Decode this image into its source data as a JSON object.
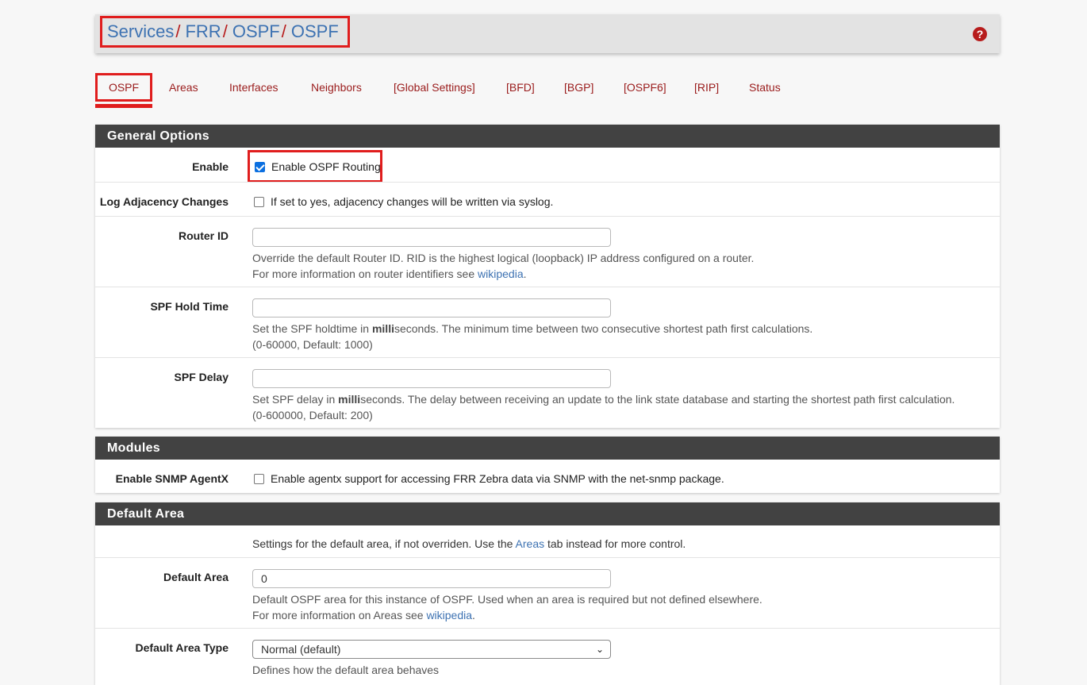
{
  "breadcrumb": [
    "Services",
    "FRR",
    "OSPF",
    "OSPF"
  ],
  "breadcrumb_separator": "/",
  "tabs": [
    {
      "label": "OSPF",
      "active": true
    },
    {
      "label": "Areas"
    },
    {
      "label": "Interfaces"
    },
    {
      "label": "Neighbors"
    },
    {
      "label": "[Global Settings]"
    },
    {
      "label": "[BFD]"
    },
    {
      "label": "[BGP]"
    },
    {
      "label": "[OSPF6]"
    },
    {
      "label": "[RIP]"
    },
    {
      "label": "Status"
    }
  ],
  "general": {
    "heading": "General Options",
    "enable": {
      "label": "Enable",
      "checkbox_text": "Enable OSPF Routing",
      "checked": true
    },
    "log_adjacency": {
      "label": "Log Adjacency Changes",
      "checkbox_text": "If set to yes, adjacency changes will be written via syslog.",
      "checked": false
    },
    "router_id": {
      "label": "Router ID",
      "value": "",
      "help1": "Override the default Router ID. RID is the highest logical (loopback) IP address configured on a router.",
      "help2_prefix": "For more information on router identifiers see ",
      "help2_link": "wikipedia",
      "help2_suffix": "."
    },
    "spf_hold": {
      "label": "SPF Hold Time",
      "value": "",
      "help1_prefix": "Set the SPF holdtime in ",
      "help1_bold": "milli",
      "help1_suffix": "seconds. The minimum time between two consecutive shortest path first calculations.",
      "help2": "(0-60000, Default: 1000)"
    },
    "spf_delay": {
      "label": "SPF Delay",
      "value": "",
      "help1_prefix": "Set SPF delay in ",
      "help1_bold": "milli",
      "help1_suffix": "seconds. The delay between receiving an update to the link state database and starting the shortest path first calculation.",
      "help2": "(0-600000, Default: 200)"
    }
  },
  "modules": {
    "heading": "Modules",
    "snmp": {
      "label": "Enable SNMP AgentX",
      "checkbox_text": "Enable agentx support for accessing FRR Zebra data via SNMP with the net-snmp package.",
      "checked": false
    }
  },
  "default_area": {
    "heading": "Default Area",
    "intro_prefix": "Settings for the default area, if not overriden. Use the ",
    "intro_link": "Areas",
    "intro_suffix": " tab instead for more control.",
    "area": {
      "label": "Default Area",
      "value": "0",
      "help1": "Default OSPF area for this instance of OSPF. Used when an area is required but not defined elsewhere.",
      "help2_prefix": "For more information on Areas see ",
      "help2_link": "wikipedia",
      "help2_suffix": "."
    },
    "area_type": {
      "label": "Default Area Type",
      "selected": "Normal (default)",
      "help": "Defines how the default area behaves"
    }
  },
  "colors": {
    "accent_red": "#e01d1d",
    "link_blue": "#3d72b2",
    "heading_dark": "#424242"
  },
  "icons": {
    "help": "question-circle-icon",
    "select": "chevron-down-icon"
  }
}
